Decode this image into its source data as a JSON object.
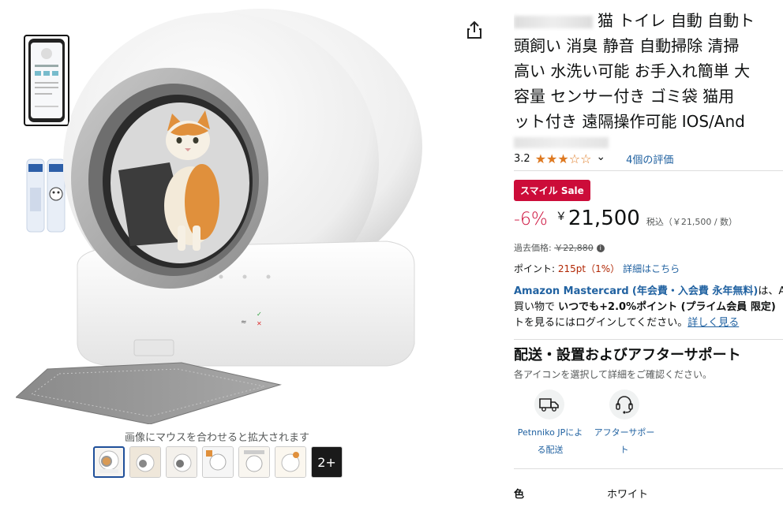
{
  "gallery": {
    "hover_caption": "画像にマウスを合わせると拡大されます",
    "more_label": "2+",
    "thumbnail_count": 7
  },
  "product": {
    "title_lines": [
      "猫 トイレ 自動 自動ト",
      "頭飼い 消臭 静音 自動掃除 清掃",
      "高い 水洗い可能 お手入れ簡単 大",
      "容量 センサー付き ゴミ袋 猫用",
      "ット付き 遠隔操作可能 IOS/And"
    ],
    "rating_value": "3.2",
    "stars": "★★★☆☆",
    "rating_caret": "⌄",
    "review_count": "4個の評価",
    "sale_badge": "スマイル Sale",
    "discount": "-6%",
    "currency": "￥",
    "price": "21,500",
    "tax_note": "税込（￥21,500 / 数）",
    "past_price_label": "過去価格: ",
    "past_price": "￥22,880",
    "points_label": "ポイント: ",
    "points_value": "215pt（1%）",
    "points_link": "詳細はこちら"
  },
  "card_promo": {
    "card_name": "Amazon Mastercard",
    "card_paren": "(年会費・入会費 永年無料)",
    "line1_tail": "は、A",
    "line2_prefix": "買い物で ",
    "line2_bold": "いつでも+2.0%ポイント",
    "line2_paren": " (プライム会員 限定)",
    "line3_text": "トを見るにはログインしてください。",
    "line3_link": "詳しく見る"
  },
  "delivery": {
    "title": "配送・設置およびアフターサポート",
    "subtitle": "各アイコンを選択して詳細をご確認ください。",
    "items": [
      {
        "label_line1": "Petnniko JPによ",
        "label_line2": "る配送",
        "icon": "truck-icon"
      },
      {
        "label_line1": "アフターサポー",
        "label_line2": "ト",
        "icon": "headset-icon"
      }
    ]
  },
  "attributes": {
    "color_label": "色",
    "color_value": "ホワイト"
  },
  "colors": {
    "sale_red": "#cc0c39",
    "link_blue": "#2162a1",
    "star_orange": "#de7921"
  }
}
